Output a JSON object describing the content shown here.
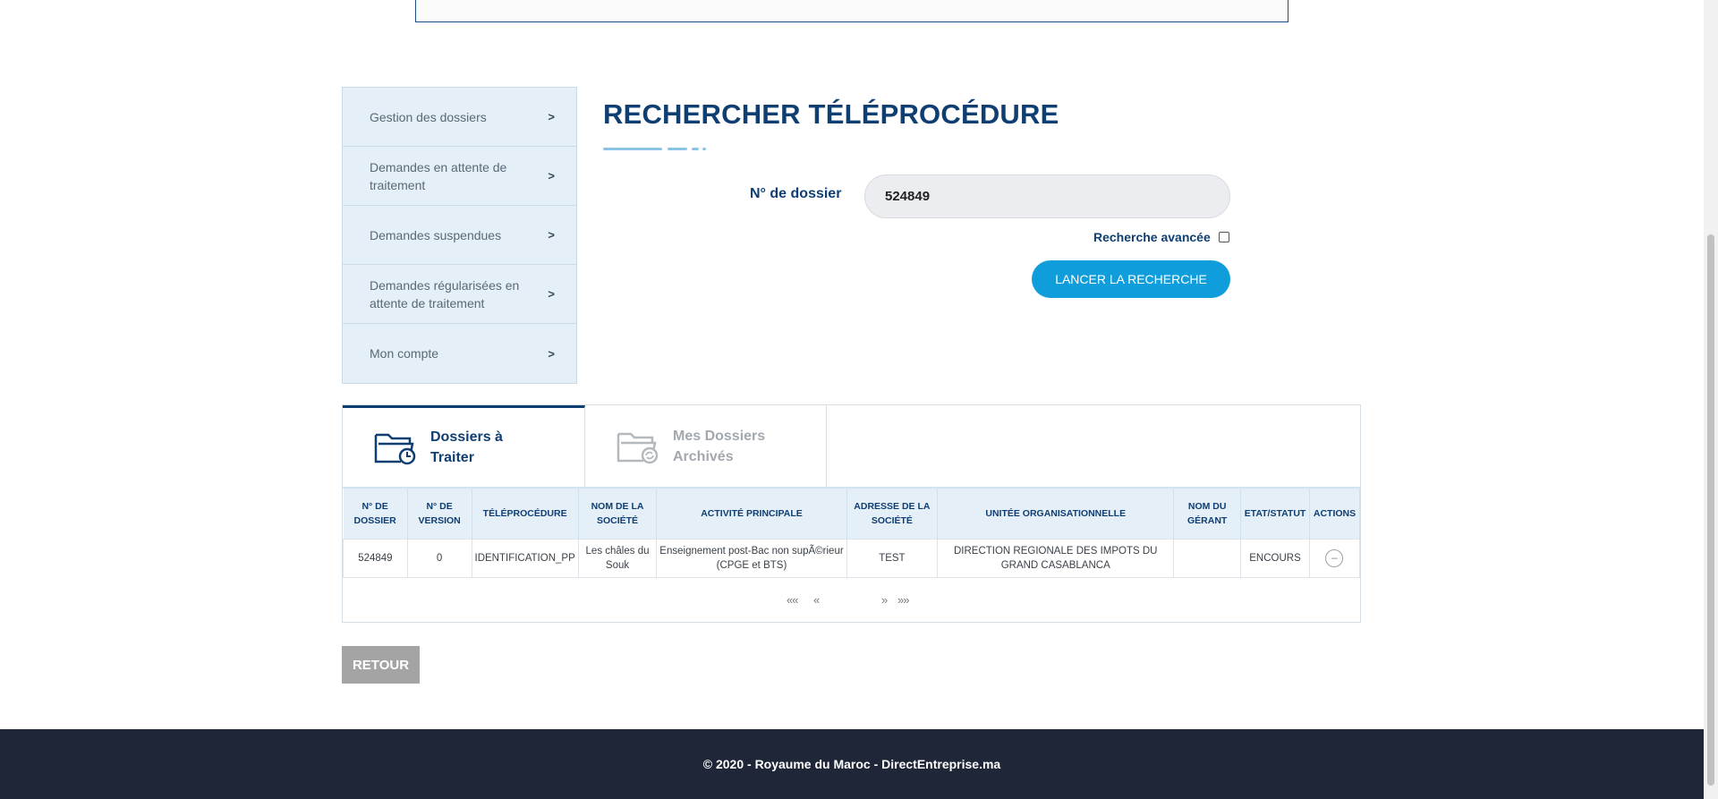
{
  "sidebar": {
    "items": [
      {
        "label": "Gestion des dossiers"
      },
      {
        "label": "Demandes en attente de traitement"
      },
      {
        "label": "Demandes suspendues"
      },
      {
        "label": "Demandes régularisées en attente de traitement"
      },
      {
        "label": "Mon compte"
      }
    ],
    "chevron": ">"
  },
  "main": {
    "title": "RECHERCHER TÉLÉPROCÉDURE",
    "dossier_label": "N° de dossier",
    "dossier_value": "524849",
    "advanced_label": "Recherche avancée",
    "advanced_checked": false,
    "search_button": "LANCER LA RECHERCHE"
  },
  "tabs": [
    {
      "label": "Dossiers à Traiter",
      "icon": "folder-clock-icon",
      "active": true
    },
    {
      "label": "Mes Dossiers Archivés",
      "icon": "folder-refresh-icon",
      "active": false
    }
  ],
  "table": {
    "headers": [
      "N° DE DOSSIER",
      "N° DE VERSION",
      "TÉLÉPROCÉDURE",
      "NOM DE LA SOCIÉTÉ",
      "ACTIVITÉ PRINCIPALE",
      "ADRESSE DE LA SOCIÉTÉ",
      "UNITÉE ORGANISATIONNELLE",
      "NOM DU GÉRANT",
      "ETAT/STATUT",
      "ACTIONS"
    ],
    "rows": [
      {
        "dossier": "524849",
        "version": "0",
        "teleprocedure": "IDENTIFICATION_PP",
        "societe": "Les châles du Souk",
        "activite": "Enseignement post-Bac non supÃ©rieur (CPGE et BTS)",
        "adresse": "TEST",
        "unite": "DIRECTION REGIONALE DES IMPOTS DU GRAND CASABLANCA",
        "gerant": "",
        "statut": "ENCOURS",
        "action": "–"
      }
    ]
  },
  "pager": {
    "first": "««",
    "prev": "«",
    "next": "»",
    "last": "»»"
  },
  "retour_button": "RETOUR",
  "footer": {
    "text": "© 2020 - Royaume du Maroc - DirectEntreprise.ma"
  },
  "colors": {
    "primary": "#0f3f72",
    "accent": "#109ddb",
    "sidebar_bg": "#e4eff7",
    "footer_bg": "#1e2638"
  }
}
